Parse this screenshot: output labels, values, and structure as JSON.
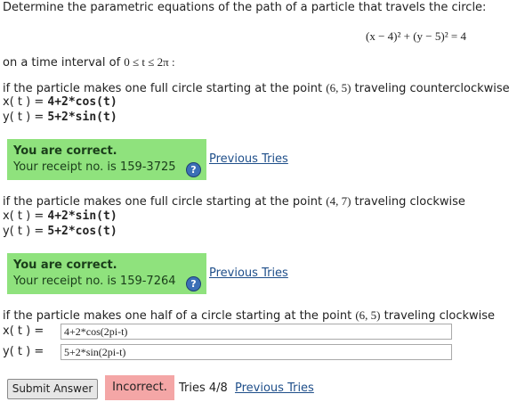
{
  "problem": {
    "intro": "Determine the parametric equations of the path of a particle that travels the circle:",
    "equation": "(x − 4)² + (y − 5)² = 4",
    "interval_prefix": "on a time interval of",
    "interval_math": "0 ≤ t ≤ 2π :"
  },
  "parts": [
    {
      "prompt_before": "if the particle makes one full circle starting at the point",
      "point": "(6, 5)",
      "prompt_after": "traveling counterclockwise",
      "x_label": "x( t ) =",
      "x_answer": "4+2*cos(t)",
      "y_label": "y( t ) =",
      "y_answer": "5+2*sin(t)",
      "result": "You are correct.",
      "receipt": "Your receipt no. is 159-3725",
      "prev_link": "Previous Tries"
    },
    {
      "prompt_before": "if the particle makes one full circle starting at the point",
      "point": "(4, 7)",
      "prompt_after": "traveling clockwise",
      "x_label": "x( t ) =",
      "x_answer": "4+2*sin(t)",
      "y_label": "y( t ) =",
      "y_answer": "5+2*cos(t)",
      "result": "You are correct.",
      "receipt": "Your receipt no. is 159-7264",
      "prev_link": "Previous Tries"
    },
    {
      "prompt_before": "if the particle makes one half of a circle starting at the point",
      "point": "(6, 5)",
      "prompt_after": "traveling clockwise",
      "x_label": "x( t ) =",
      "x_value": "4+2*cos(2pi-t)",
      "y_label": "y( t ) =",
      "y_value": "5+2*sin(2pi-t)",
      "submit_label": "Submit Answer",
      "status": "Incorrect.",
      "tries": "Tries 4/8",
      "prev_link": "Previous Tries"
    }
  ],
  "help_icon_glyph": "?",
  "colors": {
    "correct_bg": "#8fe27d",
    "incorrect_bg": "#f4a6a6",
    "link": "#1f4f8a",
    "help_icon": "#3b6fb6"
  }
}
